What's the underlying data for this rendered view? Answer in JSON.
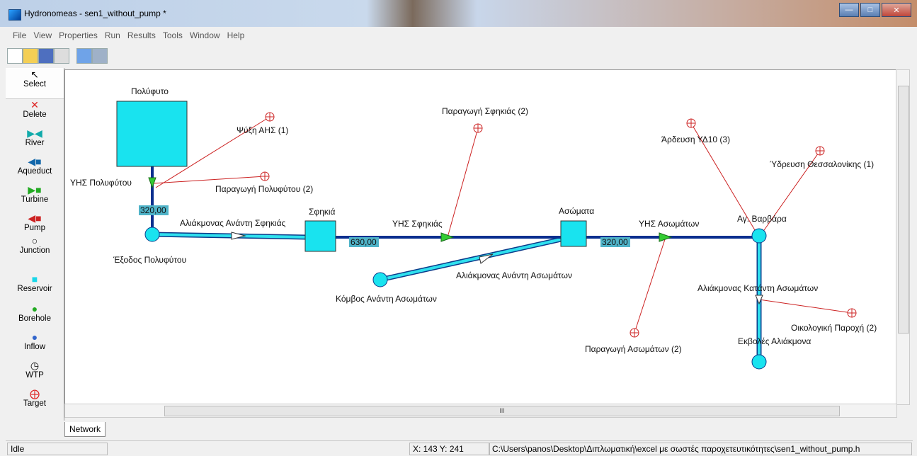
{
  "window": {
    "title": "Hydronomeas - sen1_without_pump *"
  },
  "menu": [
    "File",
    "View",
    "Properties",
    "Run",
    "Results",
    "Tools",
    "Window",
    "Help"
  ],
  "palette": [
    {
      "label": "Select",
      "icon": "cursor-icon"
    },
    {
      "label": "Delete",
      "icon": "delete-x-icon"
    },
    {
      "label": "River",
      "icon": "river-icon"
    },
    {
      "label": "Aqueduct",
      "icon": "aqueduct-icon"
    },
    {
      "label": "Turbine",
      "icon": "turbine-icon"
    },
    {
      "label": "Pump",
      "icon": "pump-icon"
    },
    {
      "label": "Junction",
      "icon": "junction-icon"
    },
    {
      "label": "Reservoir",
      "icon": "reservoir-icon"
    },
    {
      "label": "Borehole",
      "icon": "borehole-icon"
    },
    {
      "label": "Inflow",
      "icon": "inflow-icon"
    },
    {
      "label": "WTP",
      "icon": "wtp-icon"
    },
    {
      "label": "Target",
      "icon": "target-icon"
    }
  ],
  "network": {
    "labels": {
      "reservoir_polyfyto": "Πολύφυτο",
      "target_psyxi": "Ψύξη ΑΗΣ (1)",
      "turbine_polyfyto": "ΥΗΣ Πολυφύτου",
      "target_paragogi_polyfyto": "Παραγωγή Πολυφύτου (2)",
      "cap_polyfyto": "320,00",
      "junction_exodos": "Έξοδος Πολυφύτου",
      "river_sfikias": "Αλιάκμονας Ανάντη Σφηκιάς",
      "reservoir_sfikia": "Σφηκιά",
      "cap_sfikia": "630,00",
      "turbine_sfikia": "ΥΗΣ Σφηκιάς",
      "target_paragogi_sfikia": "Παραγωγή Σφηκιάς (2)",
      "junction_komvos": "Κόμβος Ανάντη Ασωμάτων",
      "river_asomaton": "Αλιάκμονας Ανάντη Ασωμάτων",
      "reservoir_asomata": "Ασώματα",
      "cap_asomata": "320,00",
      "turbine_asomata": "ΥΗΣ Ασωμάτων",
      "target_paragogi_asomata": "Παραγωγή Ασωμάτων (2)",
      "junction_varvara": "Αγ. Βαρβάρα",
      "target_ardefsi": "Άρδευση ΥΔ10 (3)",
      "target_ydrefsi": "Ύδρευση Θεσσαλονίκης (1)",
      "river_katanti": "Αλιάκμονας Κατάντη Ασωμάτων",
      "target_oikologiki": "Οικολογική Παροχή (2)",
      "junction_ekvoles": "Εκβολές Αλιάκμονα"
    }
  },
  "hscroll": {
    "grip": "III"
  },
  "tabs": [
    "Network"
  ],
  "status": {
    "state": "Idle",
    "coords": "X: 143 Y: 241",
    "path": "C:\\Users\\panos\\Desktop\\Διπλωματική\\excel με σωστές παροχετευτικότητες\\sen1_without_pump.h"
  }
}
